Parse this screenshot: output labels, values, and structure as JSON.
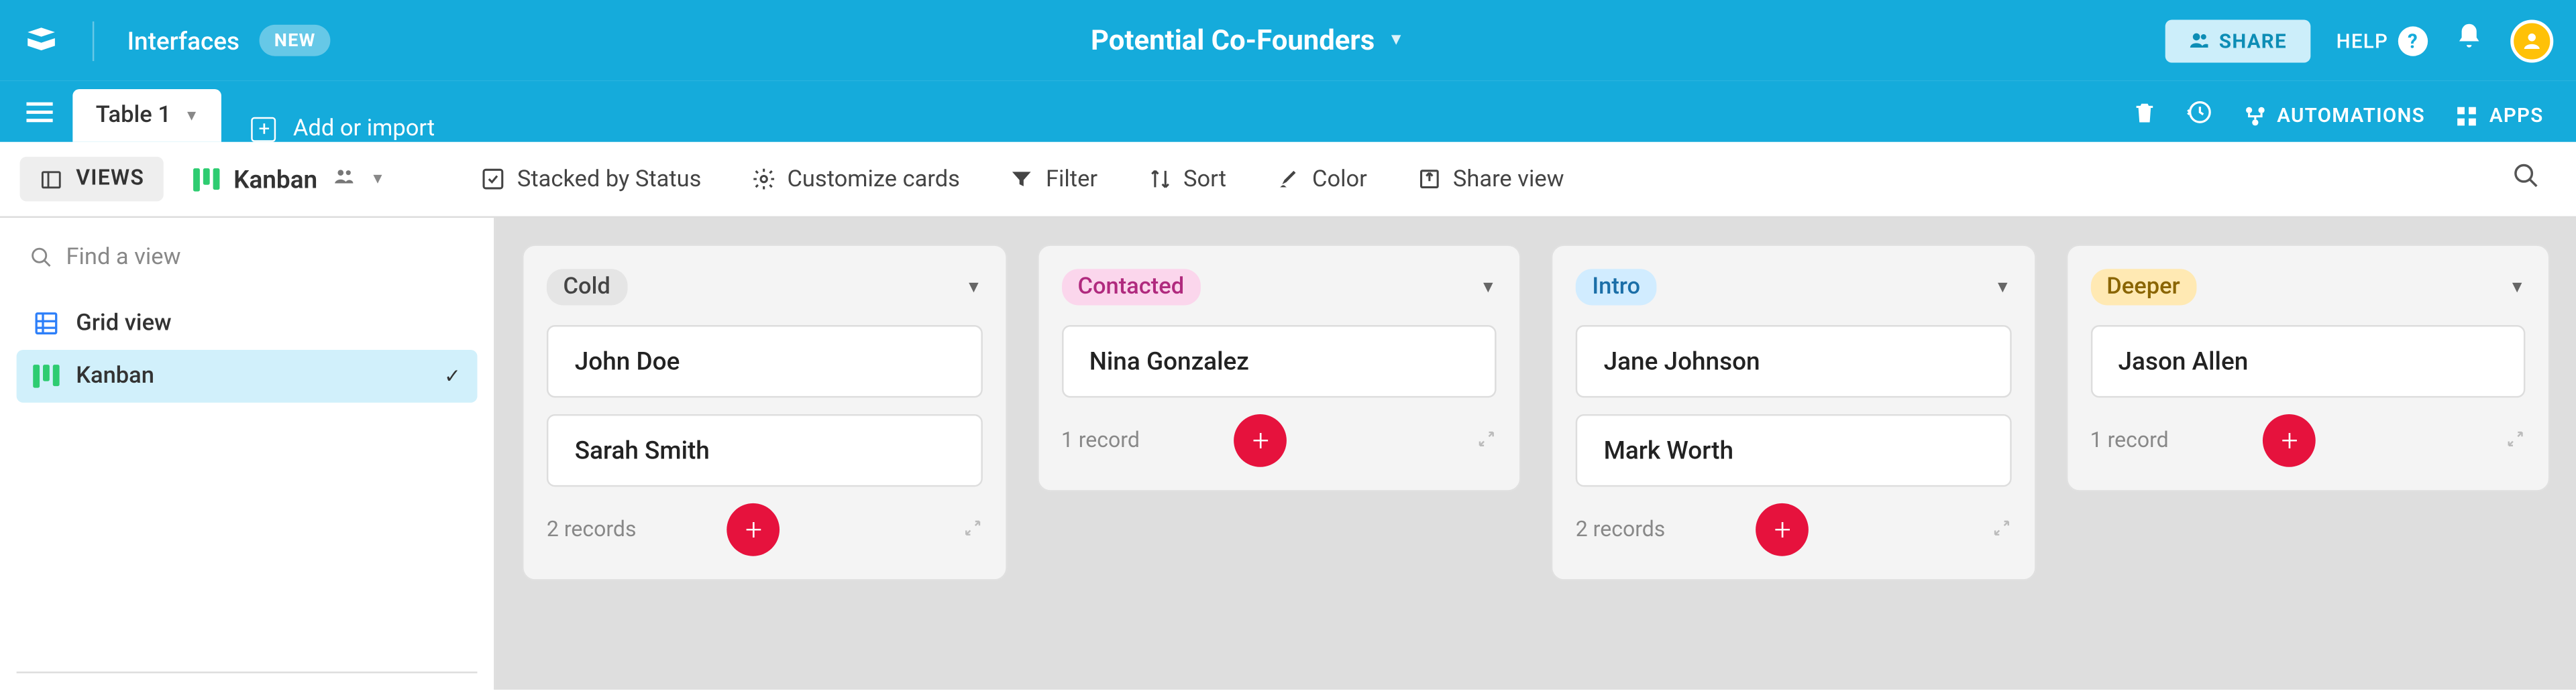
{
  "header": {
    "interfaces": "Interfaces",
    "new_badge": "NEW",
    "title": "Potential Co-Founders",
    "share": "SHARE",
    "help": "HELP"
  },
  "tabs": {
    "table1": "Table 1",
    "add_or_import": "Add or import",
    "automations": "AUTOMATIONS",
    "apps": "APPS"
  },
  "toolbar": {
    "views": "VIEWS",
    "kanban": "Kanban",
    "stacked": "Stacked by Status",
    "customize": "Customize cards",
    "filter": "Filter",
    "sort": "Sort",
    "color": "Color",
    "share_view": "Share view"
  },
  "sidebar": {
    "search_placeholder": "Find a view",
    "grid": "Grid view",
    "kanban": "Kanban"
  },
  "columns": [
    {
      "key": "cold",
      "label": "Cold",
      "pill": "cold",
      "cards": [
        "John Doe",
        "Sarah Smith"
      ],
      "count": "2 records"
    },
    {
      "key": "contacted",
      "label": "Contacted",
      "pill": "contacted",
      "cards": [
        "Nina Gonzalez"
      ],
      "count": "1 record"
    },
    {
      "key": "intro",
      "label": "Intro",
      "pill": "intro",
      "cards": [
        "Jane Johnson",
        "Mark Worth"
      ],
      "count": "2 records"
    },
    {
      "key": "deeper",
      "label": "Deeper",
      "pill": "deeper",
      "cards": [
        "Jason Allen"
      ],
      "count": "1 record"
    }
  ]
}
